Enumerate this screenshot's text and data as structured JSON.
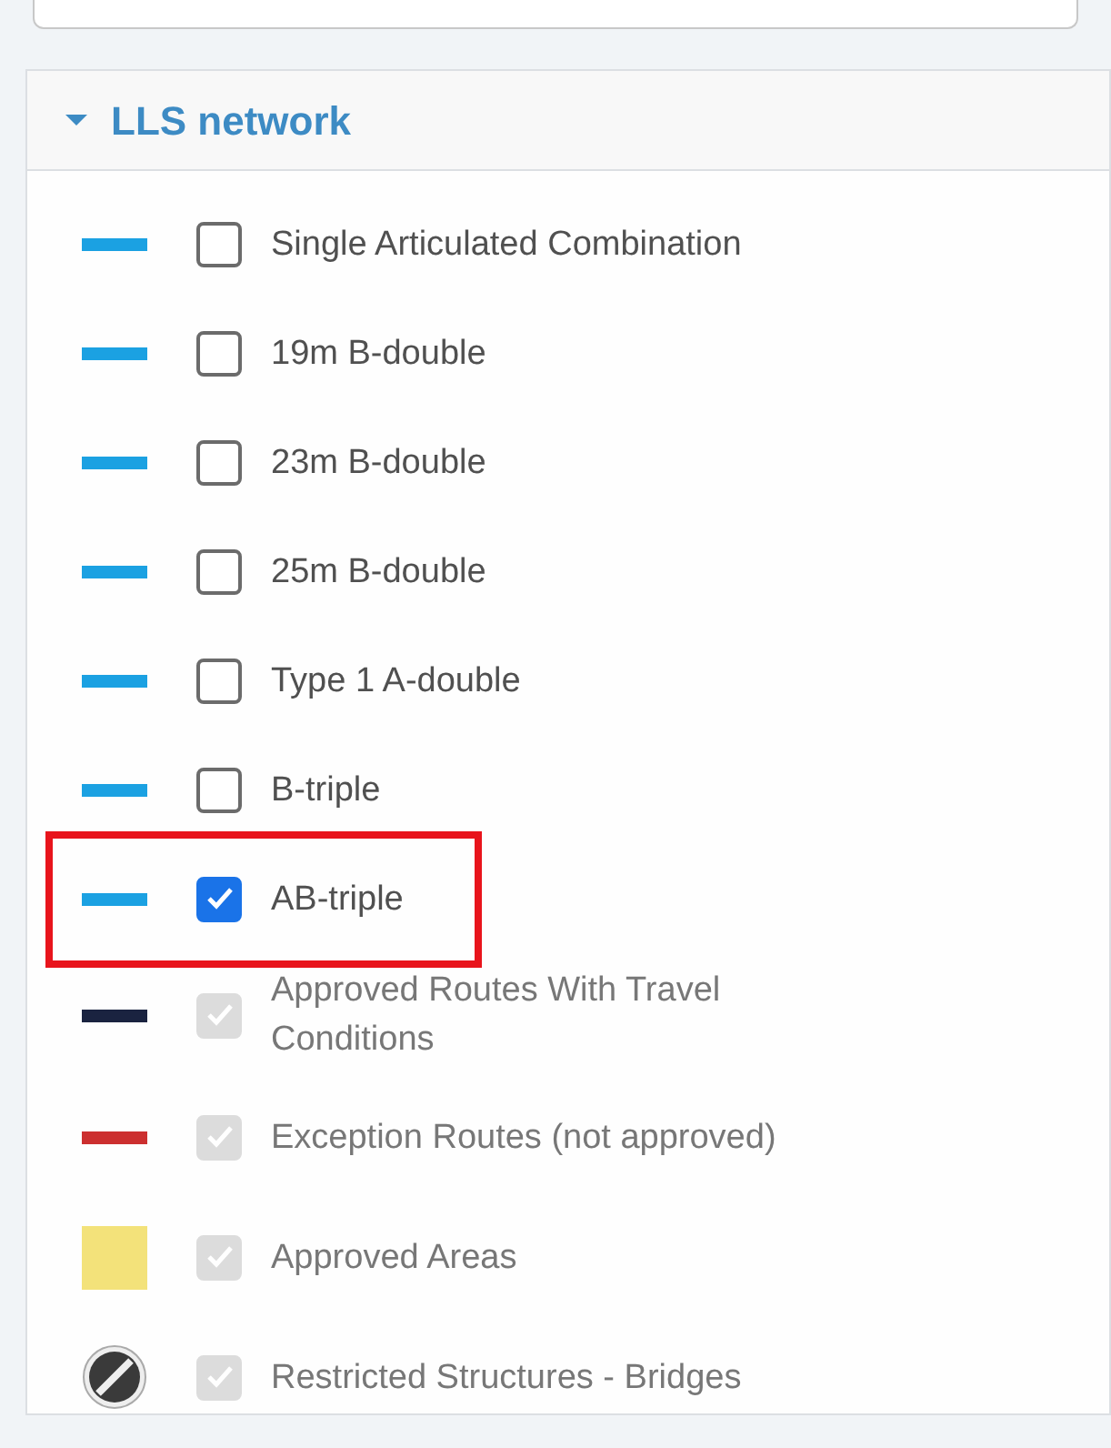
{
  "section": {
    "title": "LLS network",
    "expanded": true
  },
  "items": [
    {
      "label": "Single Articulated Combination",
      "kind": "line",
      "color": "#1ba1e2",
      "checked": false,
      "disabled": false,
      "highlighted": false
    },
    {
      "label": "19m B-double",
      "kind": "line",
      "color": "#1ba1e2",
      "checked": false,
      "disabled": false,
      "highlighted": false
    },
    {
      "label": "23m B-double",
      "kind": "line",
      "color": "#1ba1e2",
      "checked": false,
      "disabled": false,
      "highlighted": false
    },
    {
      "label": "25m B-double",
      "kind": "line",
      "color": "#1ba1e2",
      "checked": false,
      "disabled": false,
      "highlighted": false
    },
    {
      "label": "Type 1 A-double",
      "kind": "line",
      "color": "#1ba1e2",
      "checked": false,
      "disabled": false,
      "highlighted": false
    },
    {
      "label": "B-triple",
      "kind": "line",
      "color": "#1ba1e2",
      "checked": false,
      "disabled": false,
      "highlighted": false
    },
    {
      "label": "AB-triple",
      "kind": "line",
      "color": "#1ba1e2",
      "checked": true,
      "disabled": false,
      "highlighted": true
    },
    {
      "label": "Approved Routes With Travel Conditions",
      "kind": "line",
      "color": "#1a2340",
      "checked": true,
      "disabled": true,
      "highlighted": false
    },
    {
      "label": "Exception Routes (not approved)",
      "kind": "line",
      "color": "#cc2f2f",
      "checked": true,
      "disabled": true,
      "highlighted": false
    },
    {
      "label": "Approved Areas",
      "kind": "area",
      "color": "#f3e27a",
      "checked": true,
      "disabled": true,
      "highlighted": false
    },
    {
      "label": "Restricted Structures - Bridges",
      "kind": "icon",
      "color": "#3a3a3a",
      "checked": true,
      "disabled": true,
      "highlighted": false
    }
  ]
}
